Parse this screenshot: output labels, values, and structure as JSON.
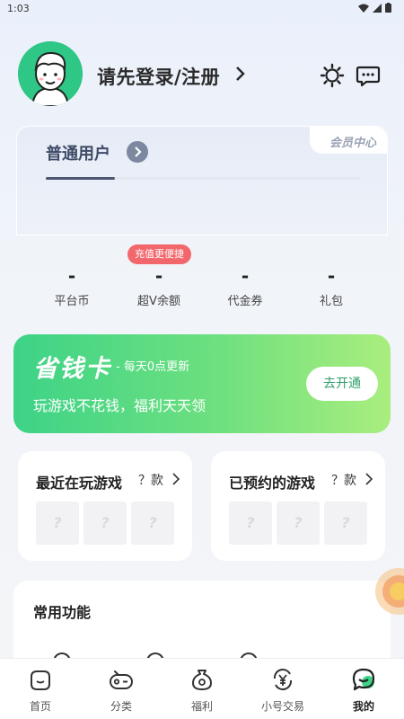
{
  "status_bar": {
    "time": "1:03"
  },
  "header": {
    "login_text": "请先登录/注册"
  },
  "member_card": {
    "title": "普通用户",
    "tab_label": "会员中心",
    "progress": 0.22
  },
  "stats": {
    "badge": "充值更便捷",
    "items": [
      {
        "value": "-",
        "label": "平台币"
      },
      {
        "value": "-",
        "label": "超V余额"
      },
      {
        "value": "-",
        "label": "代金券"
      },
      {
        "value": "-",
        "label": "礼包"
      }
    ]
  },
  "money_card": {
    "title": "省钱卡",
    "subtitle": "- 每天0点更新",
    "description": "玩游戏不花钱，福利天天领",
    "button": "去开通"
  },
  "recent_games": {
    "title": "最近在玩游戏",
    "count": "？款",
    "slots": [
      "?",
      "?",
      "?"
    ]
  },
  "reserved_games": {
    "title": "已预约的游戏",
    "count": "？款",
    "slots": [
      "?",
      "?",
      "?"
    ]
  },
  "functions": {
    "title": "常用功能"
  },
  "tabbar": {
    "items": [
      {
        "label": "首页",
        "icon": "home-icon"
      },
      {
        "label": "分类",
        "icon": "gamepad-icon"
      },
      {
        "label": "福利",
        "icon": "gift-bag-icon"
      },
      {
        "label": "小号交易",
        "icon": "yuan-exchange-icon"
      },
      {
        "label": "我的",
        "icon": "profile-icon"
      }
    ],
    "active_index": 4
  },
  "colors": {
    "brand_green": "#3dd387",
    "badge_red": "#f2676c",
    "member_text": "#3f4a66"
  }
}
